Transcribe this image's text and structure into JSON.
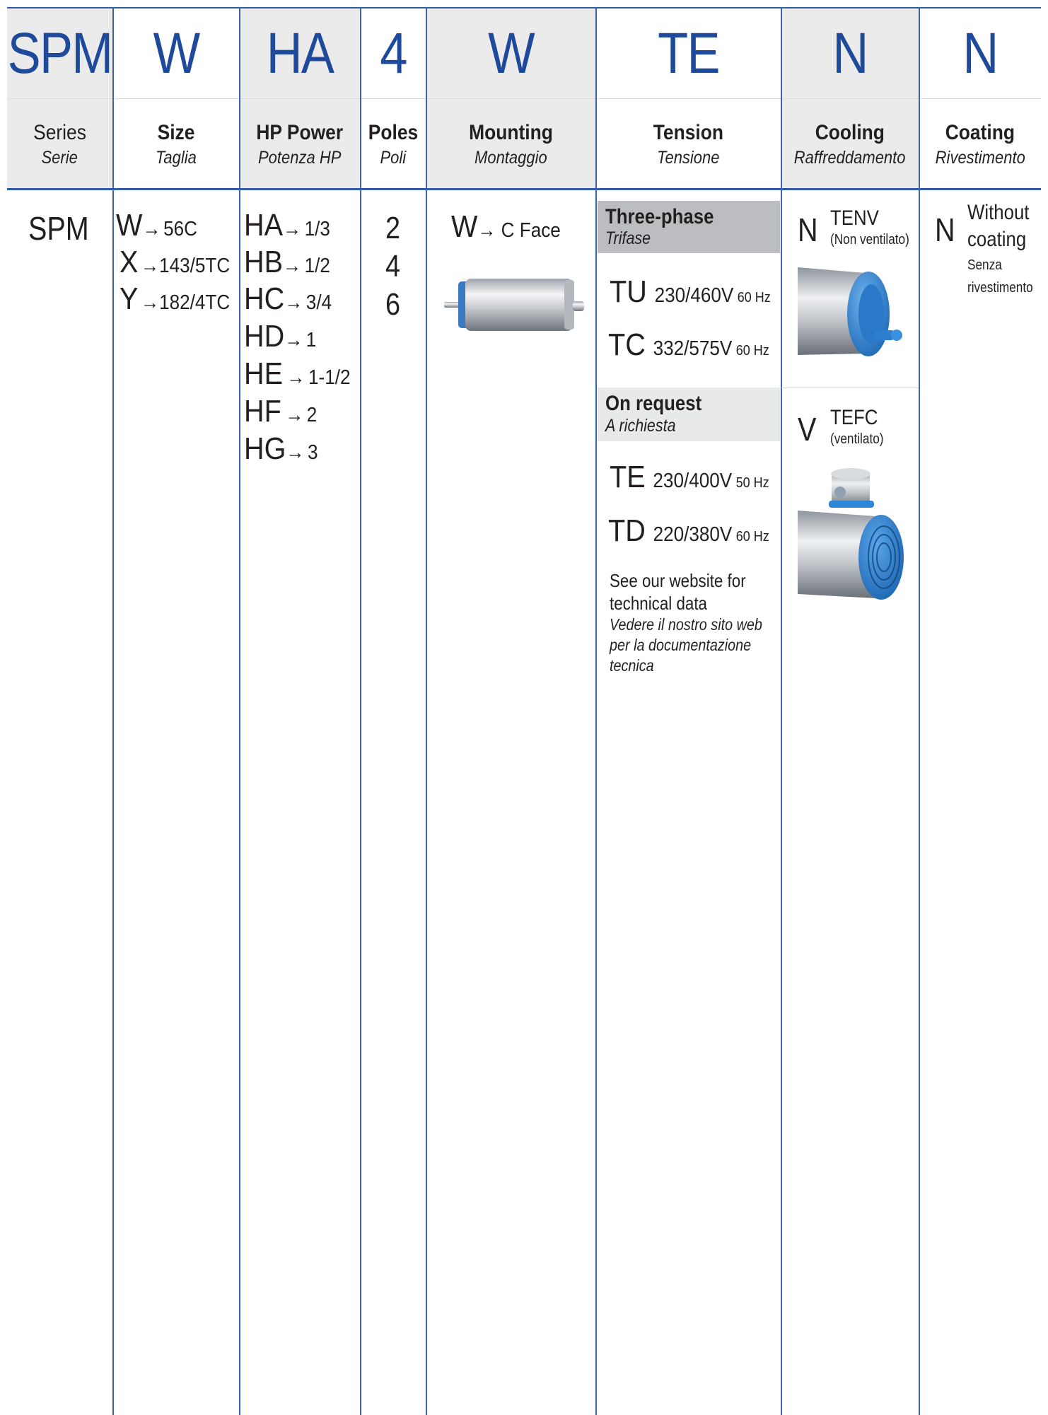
{
  "columns": [
    {
      "code": "SPM",
      "label": "Series",
      "label_it": "Serie"
    },
    {
      "code": "W",
      "label": "Size",
      "label_it": "Taglia"
    },
    {
      "code": "HA",
      "label": "HP Power",
      "label_it": "Potenza HP"
    },
    {
      "code": "4",
      "label": "Poles",
      "label_it": "Poli"
    },
    {
      "code": "W",
      "label": "Mounting",
      "label_it": "Montaggio"
    },
    {
      "code": "TE",
      "label": "Tension",
      "label_it": "Tensione"
    },
    {
      "code": "N",
      "label": "Cooling",
      "label_it": "Raffreddamento"
    },
    {
      "code": "N",
      "label": "Coating",
      "label_it": "Rivestimento"
    }
  ],
  "series": {
    "value": "SPM"
  },
  "size": {
    "options": [
      {
        "code": "W",
        "arrow": "→",
        "value": "56C"
      },
      {
        "code": "X",
        "arrow": "→",
        "value": "143/5TC"
      },
      {
        "code": "Y",
        "arrow": "→",
        "value": "182/4TC"
      }
    ]
  },
  "power": {
    "options": [
      {
        "code": "HA",
        "arrow": "→",
        "value": "1/3"
      },
      {
        "code": "HB",
        "arrow": "→",
        "value": "1/2"
      },
      {
        "code": "HC",
        "arrow": "→",
        "value": "3/4"
      },
      {
        "code": "HD",
        "arrow": "→",
        "value": "1"
      },
      {
        "code": "HE",
        "arrow": "→",
        "value": "1-1/2"
      },
      {
        "code": "HF",
        "arrow": "→",
        "value": "2"
      },
      {
        "code": "HG",
        "arrow": "→",
        "value": "3"
      }
    ]
  },
  "poles": {
    "options": [
      "2",
      "4",
      "6"
    ]
  },
  "mounting": {
    "code": "W",
    "arrow": "→",
    "value": "C Face"
  },
  "tension": {
    "three_phase": {
      "title": "Three-phase",
      "title_it": "Trifase",
      "items": [
        {
          "code": "TU",
          "voltage": "230/460V",
          "freq": "60 Hz"
        },
        {
          "code": "TC",
          "voltage": "332/575V",
          "freq": "60 Hz"
        }
      ]
    },
    "on_request": {
      "title": "On request",
      "title_it": "A richiesta",
      "items": [
        {
          "code": "TE",
          "voltage": "230/400V",
          "freq": "50 Hz"
        },
        {
          "code": "TD",
          "voltage": "220/380V",
          "freq": "60 Hz"
        }
      ]
    },
    "note": {
      "line1": "See our website for",
      "line2": "technical data",
      "it1": "Vedere il nostro sito web",
      "it2": "per la documentazione",
      "it3": "tecnica"
    }
  },
  "cooling": {
    "options": [
      {
        "code": "N",
        "name": "TENV",
        "desc": "(Non ventilato)"
      },
      {
        "code": "V",
        "name": "TEFC",
        "desc": "(ventilato)"
      }
    ]
  },
  "coating": {
    "code": "N",
    "line1": "Without",
    "line2": "coating",
    "it1": "Senza",
    "it2": "rivestimento"
  },
  "colors": {
    "accent": "#1f4a9c",
    "line": "#3d63b2",
    "gray_band": "#bcbdc0",
    "light_band": "#e8e9eb",
    "motor_blue": "#2e86d6"
  }
}
